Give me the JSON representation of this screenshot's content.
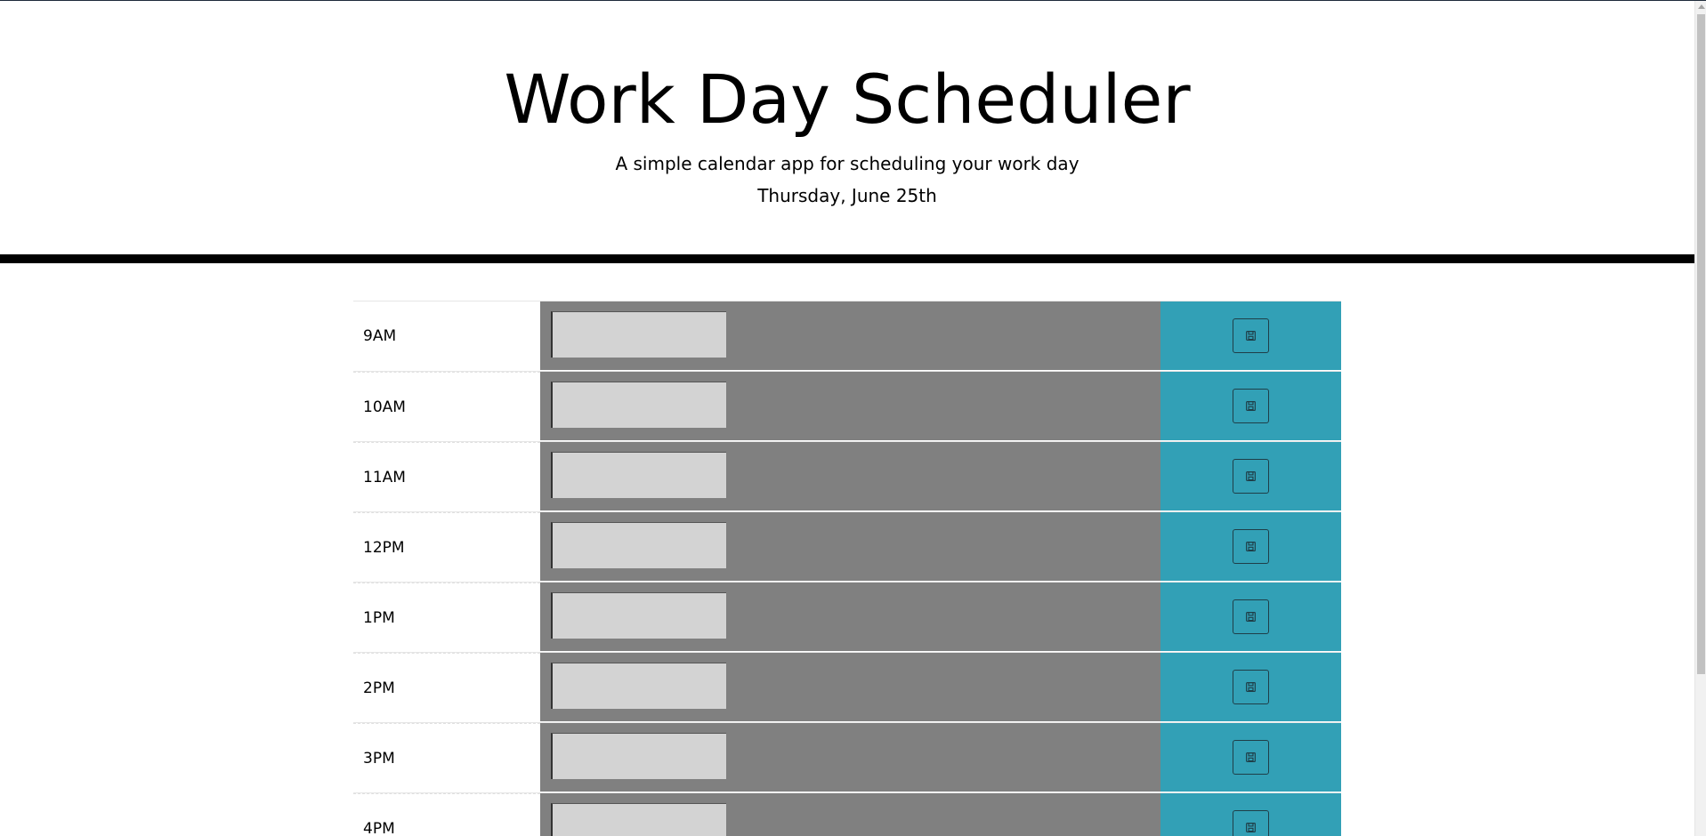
{
  "header": {
    "title": "Work Day Scheduler",
    "lead": "A simple calendar app for scheduling your work day",
    "current_day": "Thursday, June 25th"
  },
  "schedule": {
    "rows": [
      {
        "hour": "9AM",
        "text": ""
      },
      {
        "hour": "10AM",
        "text": ""
      },
      {
        "hour": "11AM",
        "text": ""
      },
      {
        "hour": "12PM",
        "text": ""
      },
      {
        "hour": "1PM",
        "text": ""
      },
      {
        "hour": "2PM",
        "text": ""
      },
      {
        "hour": "3PM",
        "text": ""
      },
      {
        "hour": "4PM",
        "text": ""
      }
    ],
    "save_icon": "save-icon"
  },
  "colors": {
    "past": "#808080",
    "save": "#32a0b6",
    "textarea": "#d3d3d3",
    "divider": "#000000"
  }
}
